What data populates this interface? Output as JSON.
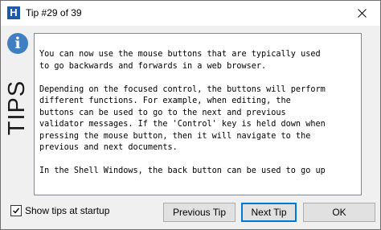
{
  "window": {
    "title": "Tip #29 of 39",
    "app_icon_letter": "H"
  },
  "sidebar": {
    "info_glyph": "i",
    "label": "TIPS"
  },
  "tip": {
    "paragraphs": [
      [
        "You can now use the mouse buttons that are typically used",
        "to go backwards and forwards in a web browser."
      ],
      [
        "Depending on the focused control, the buttons will perform",
        "different functions. For example, when editing, the",
        "buttons can be used to go to the next and previous",
        "validator messages. If the 'Control' key is held down when",
        "pressing the mouse button, then it will navigate to the",
        "previous and next documents."
      ],
      [
        "In the Shell Windows, the back button can be used to go up"
      ]
    ]
  },
  "footer": {
    "show_tips_label": "Show tips at startup",
    "show_tips_checked": true,
    "previous_label": "Previous Tip",
    "next_label": "Next Tip",
    "ok_label": "OK"
  },
  "colors": {
    "accent": "#0078d7",
    "info_icon": "#3f7fc2",
    "app_icon": "#1f5aa8"
  }
}
